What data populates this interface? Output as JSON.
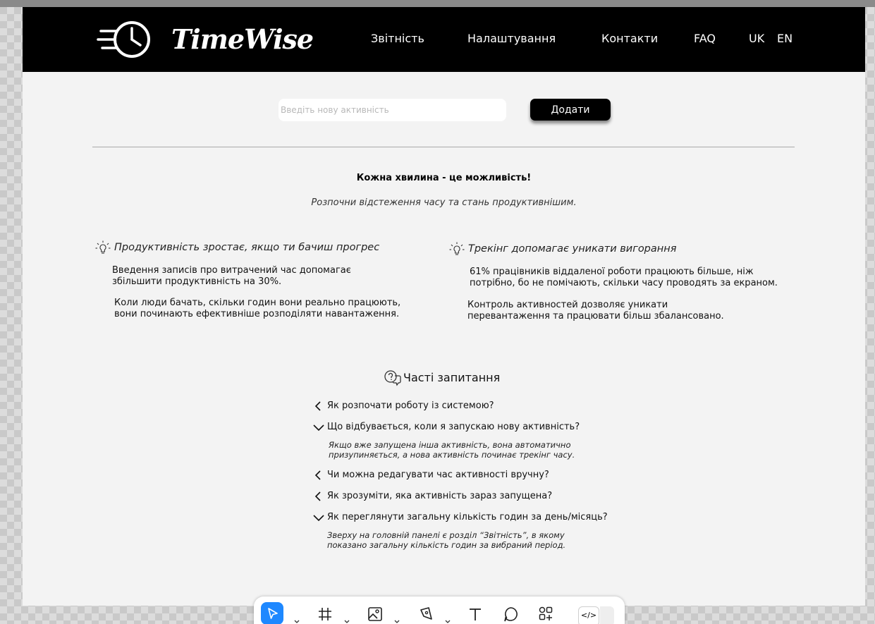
{
  "header": {
    "brand": "TimeWise",
    "logo_icon": "clock-speed-icon",
    "nav": {
      "reports": "Звітність",
      "settings": "Налаштування",
      "contacts": "Контакти",
      "faq": "FAQ",
      "lang_uk": "UK",
      "lang_en": "EN"
    }
  },
  "add_activity": {
    "placeholder": "Введіть нову активність",
    "value": "",
    "button_label": "Додати"
  },
  "hero": {
    "tagline": "Кожна хвилина - це можливість!",
    "subtagline": "Розпочни відстеження часу та стань продуктивнішим."
  },
  "tips": [
    {
      "icon": "lightbulb-icon",
      "heading": "Продуктивність зростає, якщо ти бачиш прогрес",
      "paragraphs": [
        [
          "Введення записів про витрачений час допомагає",
          "збільшити продуктивність на 30%."
        ],
        [
          "Коли люди бачать, скільки годин вони реально працюють,",
          "вони починають ефективніше розподіляти навантаження."
        ]
      ]
    },
    {
      "icon": "lightbulb-icon",
      "heading": "Трекінг допомагає уникати вигорання",
      "paragraphs": [
        [
          "61% працівників віддаленої роботи працюють більше, ніж",
          "потрібно, бо не помічають, скільки часу проводять за екраном."
        ],
        [
          "Контроль активностей дозволяє уникати",
          "перевантаження та працювати більш збалансовано."
        ]
      ]
    }
  ],
  "faq": {
    "icon": "chat-question-icon",
    "title": "Часті запитання",
    "items": [
      {
        "question": "Як розпочати роботу із системою?",
        "expanded": false,
        "answer": []
      },
      {
        "question": "Що відбувається, коли я запускаю нову активність?",
        "expanded": true,
        "answer": [
          "Якщо вже запущена інша активність, вона автоматично",
          "призупиняється, а нова активність починає трекінг часу."
        ]
      },
      {
        "question": "Чи можна редагувати час активності вручну?",
        "expanded": false,
        "answer": []
      },
      {
        "question": "Як зрозуміти, яка активність зараз запущена?",
        "expanded": false,
        "answer": []
      },
      {
        "question": "Як переглянути загальну кількість годин за день/місяць?",
        "expanded": true,
        "answer": [
          "Зверху на головній панелі є розділ “Звітність”, в якому",
          "показано загальну кількість годин за вибраний період."
        ]
      }
    ]
  },
  "toolbar": {
    "tools": [
      "move-cursor-icon",
      "frame-hash-icon",
      "image-icon",
      "pen-icon",
      "text-icon",
      "comment-icon",
      "components-icon"
    ],
    "active_tool": "move-cursor-icon",
    "code_label": "</>"
  },
  "colors": {
    "header_bg": "#000000",
    "page_bg": "#f3f3f3",
    "accent_blue": "#1e88ff"
  }
}
